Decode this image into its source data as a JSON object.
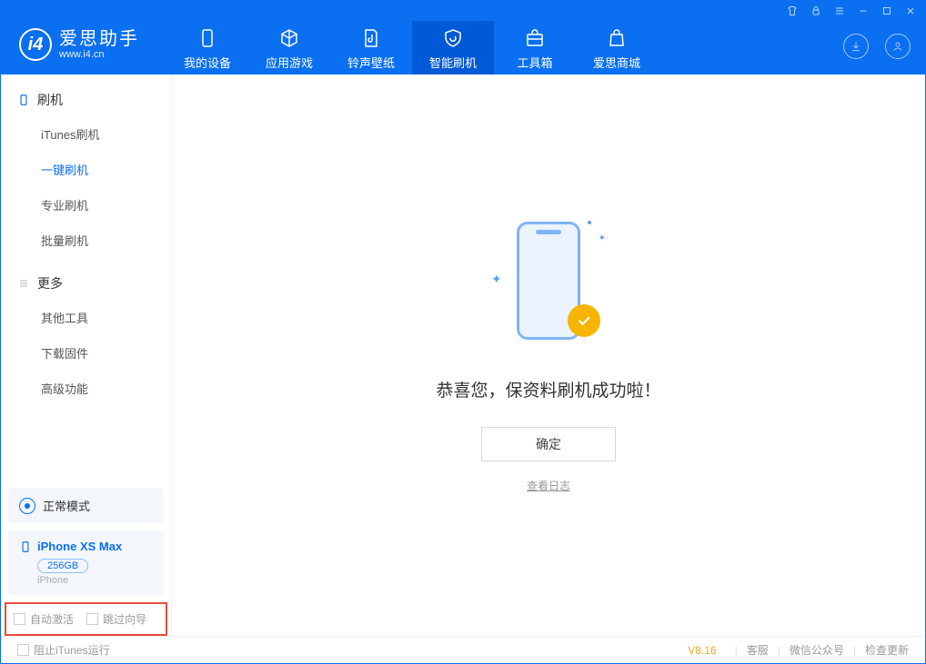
{
  "app": {
    "name": "爱思助手",
    "url": "www.i4.cn"
  },
  "tabs": [
    {
      "label": "我的设备"
    },
    {
      "label": "应用游戏"
    },
    {
      "label": "铃声壁纸"
    },
    {
      "label": "智能刷机"
    },
    {
      "label": "工具箱"
    },
    {
      "label": "爱思商城"
    }
  ],
  "sidebar": {
    "group1": {
      "title": "刷机",
      "items": [
        "iTunes刷机",
        "一键刷机",
        "专业刷机",
        "批量刷机"
      ]
    },
    "group2": {
      "title": "更多",
      "items": [
        "其他工具",
        "下载固件",
        "高级功能"
      ]
    }
  },
  "mode": "正常模式",
  "device": {
    "name": "iPhone XS Max",
    "capacity": "256GB",
    "type": "iPhone"
  },
  "options": {
    "auto_activate": "自动激活",
    "skip_guide": "跳过向导"
  },
  "main": {
    "message": "恭喜您，保资料刷机成功啦！",
    "ok": "确定",
    "log": "查看日志"
  },
  "footer": {
    "block_itunes": "阻止iTunes运行",
    "version": "V8.16",
    "links": [
      "客服",
      "微信公众号",
      "检查更新"
    ]
  }
}
